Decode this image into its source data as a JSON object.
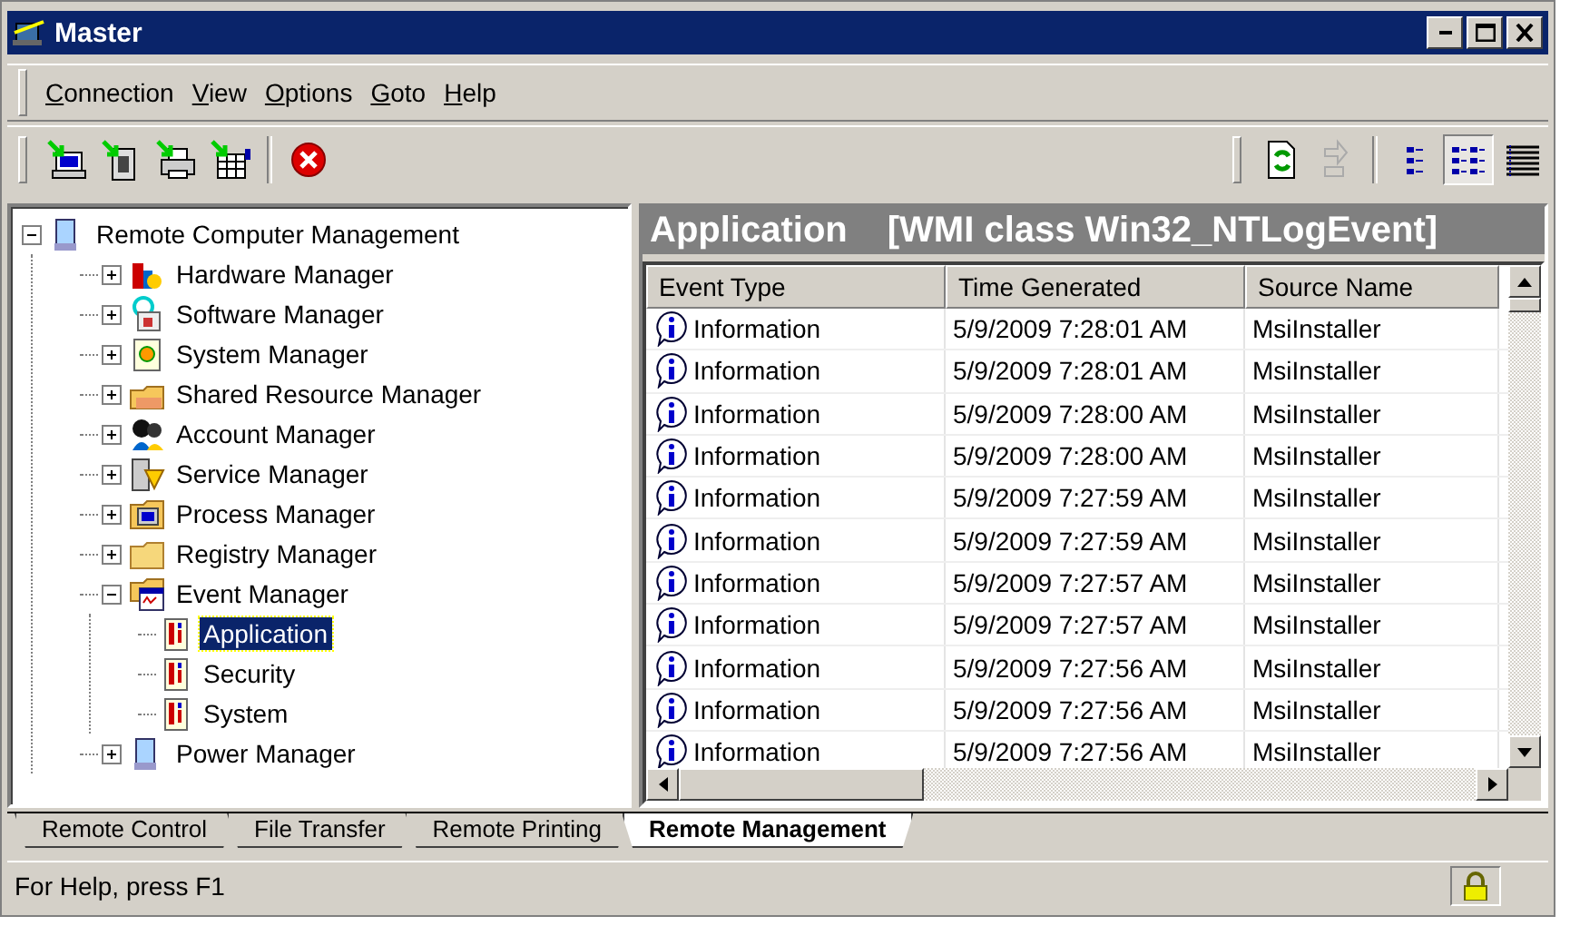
{
  "window": {
    "title": "Master"
  },
  "menu": [
    {
      "label": "Connection"
    },
    {
      "label": "View"
    },
    {
      "label": "Options"
    },
    {
      "label": "Goto"
    },
    {
      "label": "Help"
    }
  ],
  "toolbar": {
    "refresh_buttons": [
      {
        "disabled": false
      },
      {
        "disabled": true
      }
    ],
    "view_buttons": [
      {
        "selected": false
      },
      {
        "selected": true
      },
      {
        "selected": false
      }
    ]
  },
  "tree": [
    {
      "label": "Remote Computer Management",
      "expanded": true,
      "selected": false,
      "children": [
        {
          "label": "Hardware Manager",
          "expanded": false,
          "selected": false
        },
        {
          "label": "Software Manager",
          "expanded": false,
          "selected": false
        },
        {
          "label": "System Manager",
          "expanded": false,
          "selected": false
        },
        {
          "label": "Shared Resource Manager",
          "expanded": false,
          "selected": false
        },
        {
          "label": "Account Manager",
          "expanded": false,
          "selected": false
        },
        {
          "label": "Service Manager",
          "expanded": false,
          "selected": false
        },
        {
          "label": "Process Manager",
          "expanded": false,
          "selected": false
        },
        {
          "label": "Registry Manager",
          "expanded": false,
          "selected": false
        },
        {
          "label": "Event Manager",
          "expanded": true,
          "selected": false,
          "children": [
            {
              "label": "Application",
              "selected": true
            },
            {
              "label": "Security",
              "selected": false
            },
            {
              "label": "System",
              "selected": false
            }
          ]
        },
        {
          "label": "Power Manager",
          "expanded": false,
          "selected": false
        }
      ]
    }
  ],
  "panel": {
    "title": "Application",
    "subtitle": "[WMI class Win32_NTLogEvent]"
  },
  "table": {
    "columns": [
      "Event Type",
      "Time Generated",
      "Source Name"
    ],
    "rows": [
      [
        "Information",
        "5/9/2009 7:28:01 AM",
        "MsiInstaller"
      ],
      [
        "Information",
        "5/9/2009 7:28:01 AM",
        "MsiInstaller"
      ],
      [
        "Information",
        "5/9/2009 7:28:00 AM",
        "MsiInstaller"
      ],
      [
        "Information",
        "5/9/2009 7:28:00 AM",
        "MsiInstaller"
      ],
      [
        "Information",
        "5/9/2009 7:27:59 AM",
        "MsiInstaller"
      ],
      [
        "Information",
        "5/9/2009 7:27:59 AM",
        "MsiInstaller"
      ],
      [
        "Information",
        "5/9/2009 7:27:57 AM",
        "MsiInstaller"
      ],
      [
        "Information",
        "5/9/2009 7:27:57 AM",
        "MsiInstaller"
      ],
      [
        "Information",
        "5/9/2009 7:27:56 AM",
        "MsiInstaller"
      ],
      [
        "Information",
        "5/9/2009 7:27:56 AM",
        "MsiInstaller"
      ],
      [
        "Information",
        "5/9/2009 7:27:56 AM",
        "MsiInstaller"
      ]
    ]
  },
  "tabs": [
    {
      "label": "Remote Control",
      "selected": false
    },
    {
      "label": "File Transfer",
      "selected": false
    },
    {
      "label": "Remote Printing",
      "selected": false
    },
    {
      "label": "Remote Management",
      "selected": true
    }
  ],
  "status_bar": {
    "text": "For Help, press F1"
  }
}
